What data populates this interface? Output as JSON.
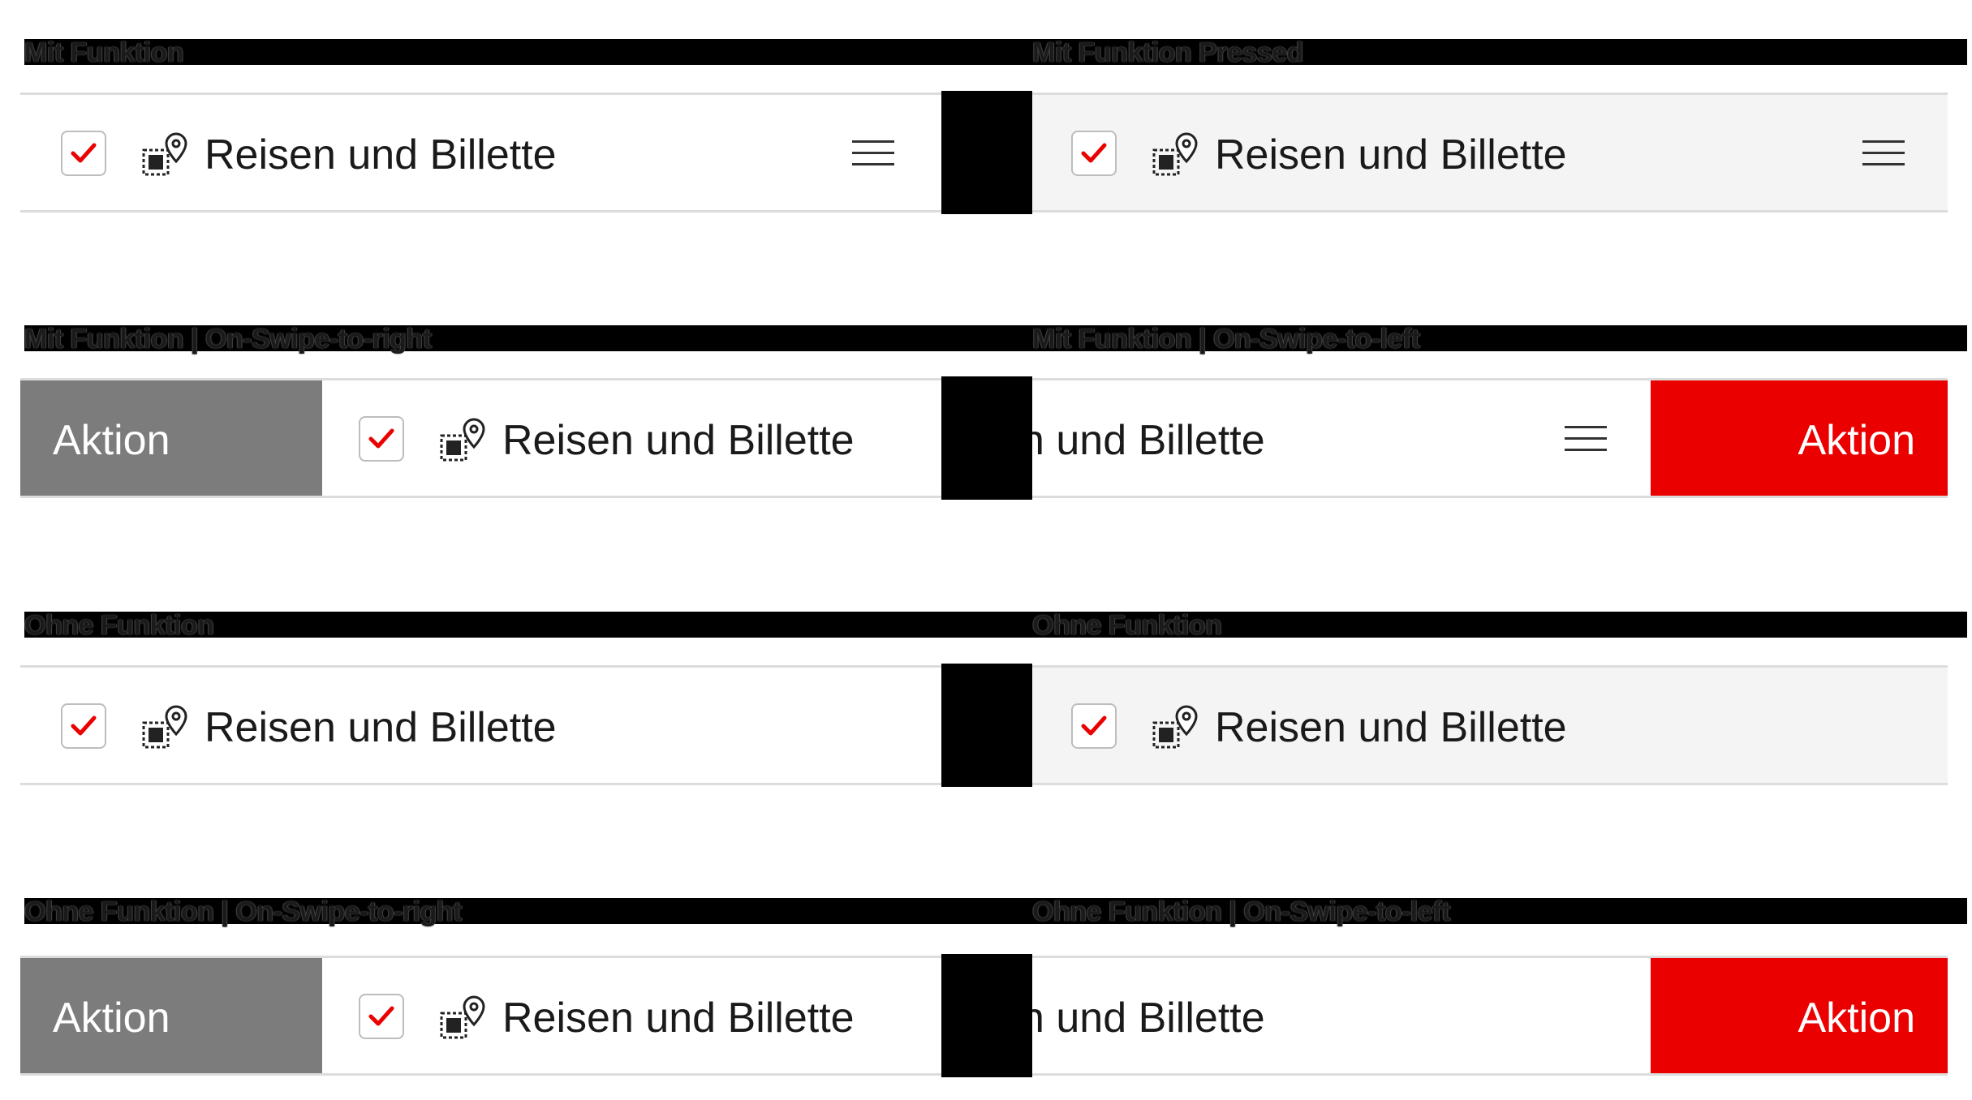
{
  "sections": [
    {
      "label": "Mit Funktion"
    },
    {
      "label": "Mit Funktion Pressed"
    },
    {
      "label": "Mit Funktion | On-Swipe-to-right"
    },
    {
      "label": "Mit Funktion | On-Swipe-to-left"
    },
    {
      "label": "Ohne Funktion"
    },
    {
      "label": "Ohne Funktion"
    },
    {
      "label": "Ohne Funktion | On-Swipe-to-right"
    },
    {
      "label": "Ohne Funktion | On-Swipe-to-left"
    }
  ],
  "item": {
    "title": "Reisen und Billette",
    "partial_title": "n und Billette",
    "checked": true
  },
  "action": {
    "label": "Aktion"
  },
  "icons": {
    "checkbox": "checkmark-icon",
    "travel": "travel-ticket-location-icon",
    "menu": "hamburger-icon"
  },
  "colors": {
    "accent": "#eb0000",
    "action_grey": "#7c7c7c",
    "pressed_bg": "#f4f4f4"
  }
}
